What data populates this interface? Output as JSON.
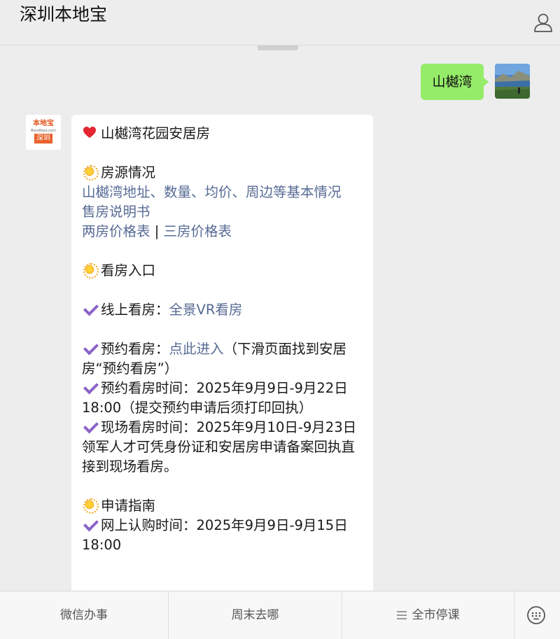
{
  "header": {
    "title": "深圳本地宝",
    "user_icon": "user-icon"
  },
  "outgoing": {
    "text": "山樾湾"
  },
  "bot": {
    "logo_top": "本地宝",
    "logo_sub": "Bendibao.com",
    "logo_tag": "深圳"
  },
  "message": {
    "title": "山樾湾花园安居房",
    "sec1_title": "房源情况",
    "link_basic": "山樾湾地址、数量、均价、周边等基本情况",
    "link_manual": "售房说明书",
    "link_two_room": "两房价格表",
    "sep": " | ",
    "link_three_room": "三房价格表",
    "sec2_title": "看房入口",
    "online_label": "线上看房：",
    "online_link": "全景VR看房",
    "appoint_label": "预约看房：",
    "appoint_link": "点此进入",
    "appoint_note": "（下滑页面找到安居房“预约看房”）",
    "appoint_time": "预约看房时间：2025年9月9日-9月22日18:00（提交预约申请后须打印回执）",
    "onsite_time": "现场看房时间：2025年9月10日-9月23日",
    "talent_note": "领军人才可凭身份证和安居房申请备案回执直接到现场看房。",
    "sec3_title": "申请指南",
    "online_buy_time": "网上认购时间：2025年9月9日-9月15日18:00"
  },
  "footer": {
    "tabs": [
      "微信办事",
      "周末去哪",
      "全市停课"
    ],
    "keyboard_icon": "keyboard-icon"
  }
}
